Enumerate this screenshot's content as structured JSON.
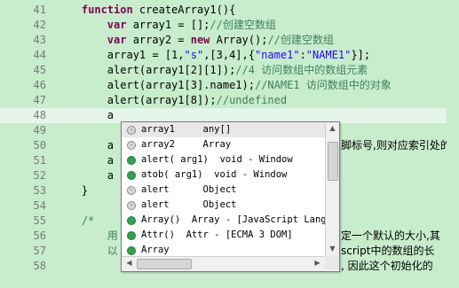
{
  "editor": {
    "lines": [
      {
        "num": "41",
        "parts": [
          {
            "t": "    ",
            "c": ""
          },
          {
            "t": "function",
            "c": "kw"
          },
          {
            "t": " createArray1(){",
            "c": ""
          }
        ]
      },
      {
        "num": "42",
        "parts": [
          {
            "t": "        ",
            "c": ""
          },
          {
            "t": "var",
            "c": "kw"
          },
          {
            "t": " array1 = [];",
            "c": ""
          },
          {
            "t": "//创建空数组",
            "c": "cmt"
          }
        ]
      },
      {
        "num": "43",
        "parts": [
          {
            "t": "        ",
            "c": ""
          },
          {
            "t": "var",
            "c": "kw"
          },
          {
            "t": " array2 = ",
            "c": ""
          },
          {
            "t": "new",
            "c": "kw"
          },
          {
            "t": " Array();",
            "c": ""
          },
          {
            "t": "//创建空数组",
            "c": "cmt"
          }
        ]
      },
      {
        "num": "44",
        "parts": [
          {
            "t": "        array1 = [1,",
            "c": ""
          },
          {
            "t": "\"s\"",
            "c": "str"
          },
          {
            "t": ",[3,4],{",
            "c": ""
          },
          {
            "t": "\"name1\"",
            "c": "str"
          },
          {
            "t": ":",
            "c": ""
          },
          {
            "t": "\"NAME1\"",
            "c": "str"
          },
          {
            "t": "}];",
            "c": ""
          }
        ]
      },
      {
        "num": "45",
        "parts": [
          {
            "t": "        alert(array1[2][1]);",
            "c": ""
          },
          {
            "t": "//4 访问数组中的数组元素",
            "c": "cmt"
          }
        ]
      },
      {
        "num": "46",
        "parts": [
          {
            "t": "        alert(array1[3].name1);",
            "c": ""
          },
          {
            "t": "//NAME1 访问数组中的对象",
            "c": "cmt"
          }
        ]
      },
      {
        "num": "47",
        "parts": [
          {
            "t": "        alert(array1[8]);",
            "c": ""
          },
          {
            "t": "//undefined",
            "c": "cmt"
          }
        ]
      },
      {
        "num": "48",
        "parts": [
          {
            "t": "        a",
            "c": ""
          }
        ]
      },
      {
        "num": "49",
        "parts": [
          {
            "t": "",
            "c": ""
          }
        ]
      },
      {
        "num": "50",
        "parts": [
          {
            "t": "        a",
            "c": ""
          }
        ]
      },
      {
        "num": "51",
        "parts": [
          {
            "t": "        a",
            "c": ""
          }
        ]
      },
      {
        "num": "52",
        "parts": [
          {
            "t": "        a",
            "c": ""
          }
        ]
      },
      {
        "num": "53",
        "parts": [
          {
            "t": "    }",
            "c": ""
          }
        ]
      },
      {
        "num": "54",
        "parts": [
          {
            "t": "",
            "c": ""
          }
        ]
      },
      {
        "num": "55",
        "parts": [
          {
            "t": "    ",
            "c": ""
          },
          {
            "t": "/*",
            "c": "cmt"
          }
        ]
      },
      {
        "num": "56",
        "parts": [
          {
            "t": "        用",
            "c": "cmt"
          }
        ]
      },
      {
        "num": "57",
        "parts": [
          {
            "t": "        以",
            "c": "cmt"
          }
        ]
      },
      {
        "num": "58",
        "parts": [
          {
            "t": "",
            "c": ""
          }
        ]
      }
    ],
    "tails": [
      {
        "line": 9,
        "text": "脚标号,则对应索引处的"
      },
      {
        "line": 15,
        "text": "定一个默认的大小,其"
      },
      {
        "line": 16,
        "text": "script中的数组的长"
      },
      {
        "line": 17,
        "text": ", 因此这个初始化的"
      }
    ]
  },
  "autocomplete": {
    "items": [
      {
        "icon": "variable-icon",
        "label": "array1     any[]"
      },
      {
        "icon": "variable-icon",
        "label": "array2     Array"
      },
      {
        "icon": "function-icon",
        "label": "alert( arg1)  void - Window"
      },
      {
        "icon": "function-icon",
        "label": "atob( arg1)  void - Window"
      },
      {
        "icon": "variable-icon",
        "label": "alert      Object"
      },
      {
        "icon": "variable-icon",
        "label": "alert      Object"
      },
      {
        "icon": "function-icon",
        "label": "Array()  Array - [JavaScript Langu"
      },
      {
        "icon": "function-icon",
        "label": "Attr()  Attr - [ECMA 3 DOM]"
      },
      {
        "icon": "function-icon",
        "label": "Array"
      }
    ],
    "selected_index": 0
  }
}
